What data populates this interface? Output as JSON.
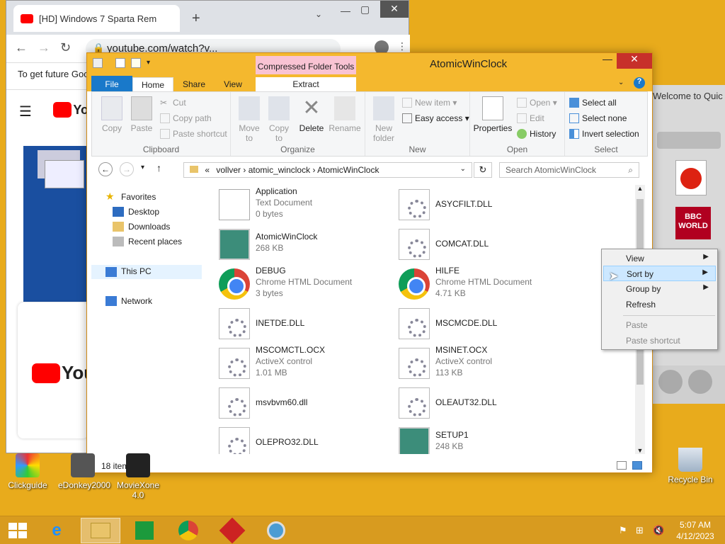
{
  "chrome": {
    "tab_title": "[HD] Windows 7 Sparta Rem",
    "url": "youtube.com/watch?v...",
    "notice": "To get future Goo",
    "yt_logo": "Yo",
    "yt_logo_big": "You"
  },
  "quicktime": {
    "title": "Welcome to Quic"
  },
  "explorer": {
    "title": "AtomicWinClock",
    "context_tab": "Compressed Folder Tools",
    "tabs": [
      "File",
      "Home",
      "Share",
      "View",
      "Extract"
    ],
    "ribbon": {
      "clipboard": {
        "label": "Clipboard",
        "copy": "Copy",
        "paste": "Paste",
        "cut": "Cut",
        "copy_path": "Copy path",
        "paste_shortcut": "Paste shortcut"
      },
      "organize": {
        "label": "Organize",
        "move_to": "Move",
        "move_to2": "to",
        "copy_to": "Copy",
        "copy_to2": "to",
        "delete": "Delete",
        "rename": "Rename"
      },
      "new": {
        "label": "New",
        "new_folder": "New",
        "new_folder2": "folder",
        "new_item": "New item",
        "easy_access": "Easy access"
      },
      "open": {
        "label": "Open",
        "properties": "Properties",
        "open": "Open",
        "edit": "Edit",
        "history": "History"
      },
      "select": {
        "label": "Select",
        "select_all": "Select all",
        "select_none": "Select none",
        "invert": "Invert selection"
      }
    },
    "path": {
      "prefix": "«",
      "parts": [
        "vollver",
        "atomic_winclock",
        "AtomicWinClock"
      ]
    },
    "search_placeholder": "Search AtomicWinClock",
    "nav": {
      "favorites": "Favorites",
      "desktop": "Desktop",
      "downloads": "Downloads",
      "recent": "Recent places",
      "this_pc": "This PC",
      "network": "Network"
    },
    "files": [
      {
        "name": "Application",
        "type": "Text Document",
        "size": "0 bytes",
        "icon": "doc"
      },
      {
        "name": "ASYCFILT.DLL",
        "type": "",
        "size": "",
        "icon": "gear"
      },
      {
        "name": "AtomicWinClock",
        "type": "",
        "size": "268 KB",
        "icon": "exe"
      },
      {
        "name": "COMCAT.DLL",
        "type": "",
        "size": "",
        "icon": "gear"
      },
      {
        "name": "DEBUG",
        "type": "Chrome HTML Document",
        "size": "3 bytes",
        "icon": "chrome"
      },
      {
        "name": "HILFE",
        "type": "Chrome HTML Document",
        "size": "4.71 KB",
        "icon": "chrome"
      },
      {
        "name": "INETDE.DLL",
        "type": "",
        "size": "",
        "icon": "gear"
      },
      {
        "name": "MSCMCDE.DLL",
        "type": "",
        "size": "",
        "icon": "gear"
      },
      {
        "name": "MSCOMCTL.OCX",
        "type": "ActiveX control",
        "size": "1.01 MB",
        "icon": "gear"
      },
      {
        "name": "MSINET.OCX",
        "type": "ActiveX control",
        "size": "113 KB",
        "icon": "gear"
      },
      {
        "name": "msvbvm60.dll",
        "type": "",
        "size": "",
        "icon": "gear"
      },
      {
        "name": "OLEAUT32.DLL",
        "type": "",
        "size": "",
        "icon": "gear"
      },
      {
        "name": "OLEPRO32.DLL",
        "type": "",
        "size": "",
        "icon": "gear"
      },
      {
        "name": "SETUP1",
        "type": "",
        "size": "248 KB",
        "icon": "exe"
      }
    ],
    "status": "18 items"
  },
  "context_menu": {
    "items": [
      "View",
      "Sort by",
      "Group by",
      "Refresh",
      "Paste",
      "Paste shortcut"
    ]
  },
  "desktop": {
    "icons": [
      "Clickguide",
      "eDonkey2000",
      "MovieXone 4.0",
      "Recycle Bin"
    ]
  },
  "clock": {
    "time": "5:07 AM",
    "date": "4/12/2023"
  },
  "colors": {
    "accent": "#f4b82e",
    "desktop": "#e8ab1c",
    "file_tab": "#1979ca"
  }
}
